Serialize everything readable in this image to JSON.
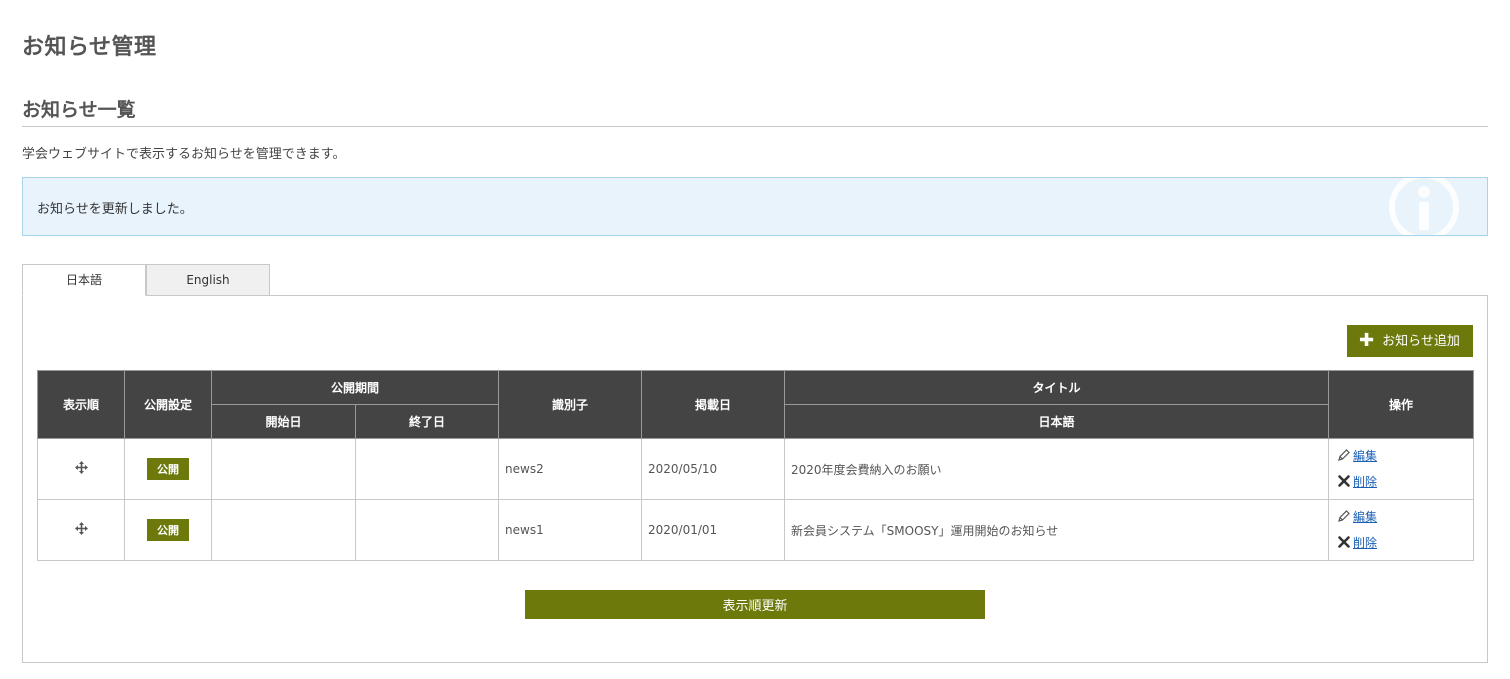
{
  "page": {
    "title": "お知らせ管理",
    "section_title": "お知らせ一覧",
    "description": "学会ウェブサイトで表示するお知らせを管理できます。"
  },
  "alert": {
    "message": "お知らせを更新しました。",
    "icon": "info-icon",
    "background": "#e8f3fb",
    "border": "#a9d2ed"
  },
  "tabs": [
    {
      "label": "日本語",
      "active": true
    },
    {
      "label": "English",
      "active": false
    }
  ],
  "toolbar": {
    "add_label": "お知らせ追加",
    "add_icon": "plus-icon"
  },
  "table": {
    "headers": {
      "order": "表示順",
      "publish_setting": "公開設定",
      "publish_period": "公開期間",
      "start_date": "開始日",
      "end_date": "終了日",
      "identifier": "識別子",
      "posted_date": "掲載日",
      "title": "タイトル",
      "title_ja": "日本語",
      "operations": "操作"
    },
    "rows": [
      {
        "status": "公開",
        "start_date": "",
        "end_date": "",
        "identifier": "news2",
        "posted_date": "2020/05/10",
        "title": "2020年度会費納入のお願い",
        "edit_label": "編集",
        "delete_label": "削除"
      },
      {
        "status": "公開",
        "start_date": "",
        "end_date": "",
        "identifier": "news1",
        "posted_date": "2020/01/01",
        "title": "新会員システム「SMOOSY」運用開始のお知らせ",
        "edit_label": "編集",
        "delete_label": "削除"
      }
    ]
  },
  "footer": {
    "update_order_label": "表示順更新"
  },
  "colors": {
    "accent": "#6d7a0b",
    "header_bg": "#444444",
    "link": "#1a5fb4"
  }
}
